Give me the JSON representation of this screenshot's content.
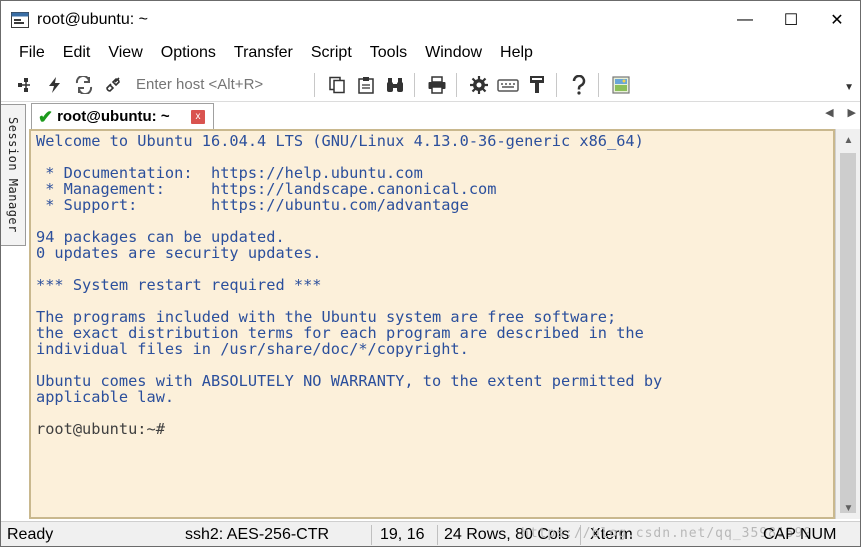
{
  "window": {
    "title": "root@ubuntu: ~",
    "controls": {
      "minimize": "—",
      "maximize": "☐",
      "close": "✕"
    }
  },
  "menu": {
    "items": [
      "File",
      "Edit",
      "View",
      "Options",
      "Transfer",
      "Script",
      "Tools",
      "Window",
      "Help"
    ]
  },
  "toolbar": {
    "host_placeholder": "Enter host <Alt+R>",
    "icons": [
      "connect-icon",
      "quick-connect-icon",
      "reconnect-icon",
      "disconnect-icon",
      "copy-icon",
      "paste-icon",
      "find-icon",
      "print-icon",
      "settings-icon",
      "keymap-icon",
      "sftp-icon",
      "help-icon",
      "screenshot-icon"
    ]
  },
  "side_panel": {
    "label": "Session Manager"
  },
  "tabs": [
    {
      "label": "root@ubuntu: ~",
      "close": "x",
      "active": true
    }
  ],
  "terminal": {
    "lines": [
      "Welcome to Ubuntu 16.04.4 LTS (GNU/Linux 4.13.0-36-generic x86_64)",
      "",
      " * Documentation:  https://help.ubuntu.com",
      " * Management:     https://landscape.canonical.com",
      " * Support:        https://ubuntu.com/advantage",
      "",
      "94 packages can be updated.",
      "0 updates are security updates.",
      "",
      "*** System restart required ***",
      "",
      "The programs included with the Ubuntu system are free software;",
      "the exact distribution terms for each program are described in the",
      "individual files in /usr/share/doc/*/copyright.",
      "",
      "Ubuntu comes with ABSOLUTELY NO WARRANTY, to the extent permitted by",
      "applicable law.",
      "",
      "root@ubuntu:~#"
    ],
    "colors": {
      "background": "#fcf0da",
      "text": "#2b4f9c",
      "border": "#c9b88e"
    }
  },
  "status": {
    "ready": "Ready",
    "cipher": "ssh2: AES-256-CTR",
    "cursor": "19, 16",
    "size": "24 Rows, 80 Cols",
    "term": "Xterm",
    "cap": "CAP",
    "num": "NUM",
    "watermark": "https://blog.csdn.net/qq_35981599"
  }
}
